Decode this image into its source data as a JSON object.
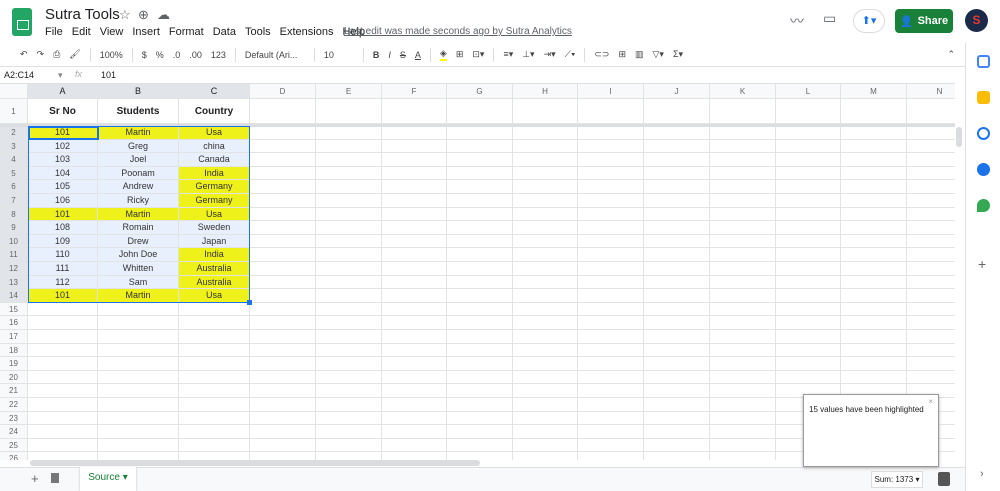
{
  "app": {
    "title": "Sutra Tools",
    "menu": [
      "File",
      "Edit",
      "View",
      "Insert",
      "Format",
      "Data",
      "Tools",
      "Extensions",
      "Help"
    ],
    "last_edit": "Last edit was made seconds ago by Sutra Analytics",
    "share": "Share",
    "avatar": "S"
  },
  "toolbar": {
    "zoom": "100%",
    "currency": "$",
    "percent": "%",
    "dec_dec": ".0",
    "dec_inc": ".00",
    "format": "123",
    "font": "Default (Ari...",
    "size": "10",
    "bold": "B",
    "italic": "I",
    "strike": "S",
    "textcolor": "A"
  },
  "formula": {
    "namebox": "A2:C14",
    "fx": "fx",
    "value": "101"
  },
  "columns": [
    "A",
    "B",
    "C",
    "D",
    "E",
    "F",
    "G",
    "H",
    "I",
    "J",
    "K",
    "L",
    "M",
    "N"
  ],
  "header_row": [
    "Sr No",
    "Students",
    "Country"
  ],
  "rows": [
    [
      "101",
      "Martin",
      "Usa"
    ],
    [
      "102",
      "Greg",
      "china"
    ],
    [
      "103",
      "Joel",
      "Canada"
    ],
    [
      "104",
      "Poonam",
      "India"
    ],
    [
      "105",
      "Andrew",
      "Germany"
    ],
    [
      "106",
      "Ricky",
      "Germany"
    ],
    [
      "101",
      "Martin",
      "Usa"
    ],
    [
      "108",
      "Romain",
      "Sweden"
    ],
    [
      "109",
      "Drew",
      "Japan"
    ],
    [
      "110",
      "John Doe",
      "India"
    ],
    [
      "111",
      "Whitten",
      "Australia"
    ],
    [
      "112",
      "Sam",
      "Australia"
    ],
    [
      "101",
      "Martin",
      "Usa"
    ]
  ],
  "highlighted": [
    [
      1,
      1,
      1
    ],
    [
      0,
      0,
      0
    ],
    [
      0,
      0,
      0
    ],
    [
      0,
      0,
      1
    ],
    [
      0,
      0,
      1
    ],
    [
      0,
      0,
      1
    ],
    [
      1,
      1,
      1
    ],
    [
      0,
      0,
      0
    ],
    [
      0,
      0,
      0
    ],
    [
      0,
      0,
      1
    ],
    [
      0,
      0,
      1
    ],
    [
      0,
      0,
      1
    ],
    [
      1,
      1,
      1
    ]
  ],
  "colors": {
    "highlight": "#eef21a",
    "selection": "#e8f0fe",
    "accent": "#188038"
  },
  "total_rows": 26,
  "toast": "15 values have been highlighted",
  "sheet_tab": "Source",
  "sum": "Sum: 1373"
}
